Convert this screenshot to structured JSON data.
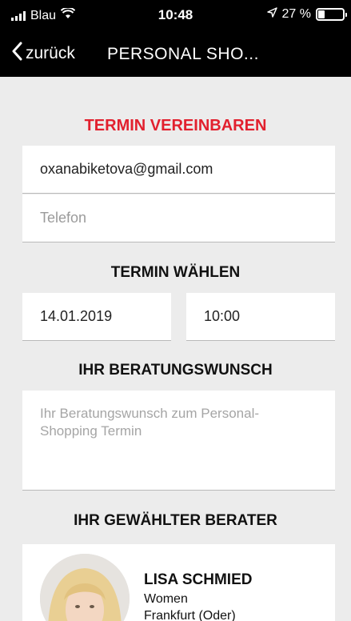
{
  "status_bar": {
    "carrier": "Blau",
    "time": "10:48",
    "battery_percent": "27 %",
    "battery_level": 0.27,
    "wifi_icon": "wifi-icon",
    "location_icon": "location-arrow-icon"
  },
  "nav": {
    "back_label": "zurück",
    "title": "PERSONAL SHO..."
  },
  "form": {
    "heading": "TERMIN VEREINBAREN",
    "email_value": "oxanabiketova@gmail.com",
    "phone_placeholder": "Telefon",
    "date_heading": "TERMIN WÄHLEN",
    "date_value": "14.01.2019",
    "time_value": "10:00",
    "request_heading": "IHR BERATUNGSWUNSCH",
    "request_placeholder": "Ihr Beratungswunsch zum Personal-Shopping Termin",
    "advisor_heading": "IHR GEWÄHLTER BERATER"
  },
  "advisor": {
    "name": "LISA SCHMIED",
    "department": "Women",
    "city": "Frankfurt (Oder)"
  },
  "colors": {
    "accent": "#e2202e",
    "background": "#ececec",
    "header": "#000000"
  }
}
